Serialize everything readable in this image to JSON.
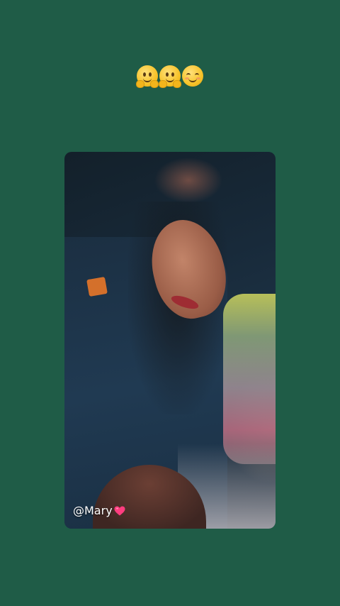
{
  "header": {
    "emojis": [
      "melting-face-icon",
      "melting-face-icon",
      "smiling-face-icon"
    ]
  },
  "story": {
    "mention": "@Mary",
    "mention_decoration": "heart-icon"
  },
  "colors": {
    "background": "#1f5c47",
    "heart": "#ff3d7f"
  }
}
